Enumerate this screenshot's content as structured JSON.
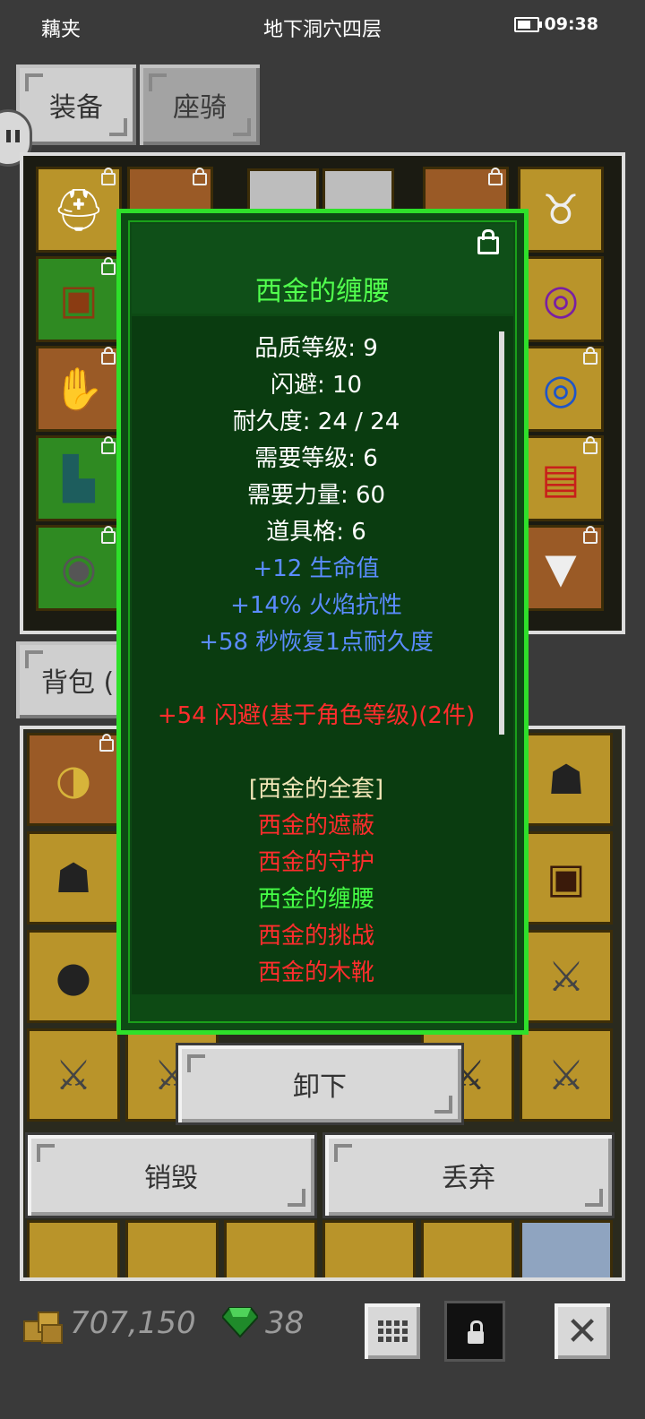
{
  "status_bar": {
    "carrier": "藕夹",
    "location": "地下洞穴四层",
    "time": "09:38",
    "battery_level": 0.7
  },
  "tabs": [
    {
      "label": "装备"
    },
    {
      "label": "座骑"
    }
  ],
  "backpack_tab": {
    "label": "背包 ("
  },
  "equipment_slots": [
    {
      "icon": "helmet-icon",
      "color": "gold"
    },
    {
      "icon": "armor-icon",
      "color": "green"
    },
    {
      "icon": "glove-icon",
      "color": "orange"
    },
    {
      "icon": "boot-icon",
      "color": "green"
    },
    {
      "icon": "belt-icon",
      "color": "green"
    },
    {
      "icon": "amulet-icon",
      "color": "gold"
    },
    {
      "icon": "ring-icon",
      "color": "gold"
    },
    {
      "icon": "ring-icon",
      "color": "gold"
    },
    {
      "icon": "book-icon",
      "color": "gold"
    },
    {
      "icon": "cape-icon",
      "color": "orange"
    }
  ],
  "tooltip": {
    "title": "西金的缠腰",
    "stats": [
      "品质等级: 9",
      "闪避: 10",
      "耐久度: 24 / 24",
      "需要等级: 6",
      "需要力量: 60",
      "道具格: 6"
    ],
    "bonuses": [
      "+12 生命值",
      "+14% 火焰抗性",
      "+58 秒恢复1点耐久度"
    ],
    "set_bonus": "+54 闪避(基于角色等级)(2件)",
    "set_name": "[西金的全套]",
    "set_items": [
      {
        "name": "西金的遮蔽",
        "owned": false
      },
      {
        "name": "西金的守护",
        "owned": false
      },
      {
        "name": "西金的缠腰",
        "owned": true
      },
      {
        "name": "西金的挑战",
        "owned": false
      },
      {
        "name": "西金的木靴",
        "owned": false
      }
    ],
    "colors": {
      "title": "#52ff4e",
      "stat": "#ffffff",
      "bonus": "#5b8cff",
      "set_bonus": "#ff2d2d",
      "set_name": "#f2e6b8",
      "owned": "#46ff46",
      "missing": "#ff2d2d"
    }
  },
  "actions": {
    "unequip": "卸下",
    "destroy": "销毁",
    "drop": "丢弃"
  },
  "currency": {
    "gold": "707,150",
    "gems": "38"
  }
}
